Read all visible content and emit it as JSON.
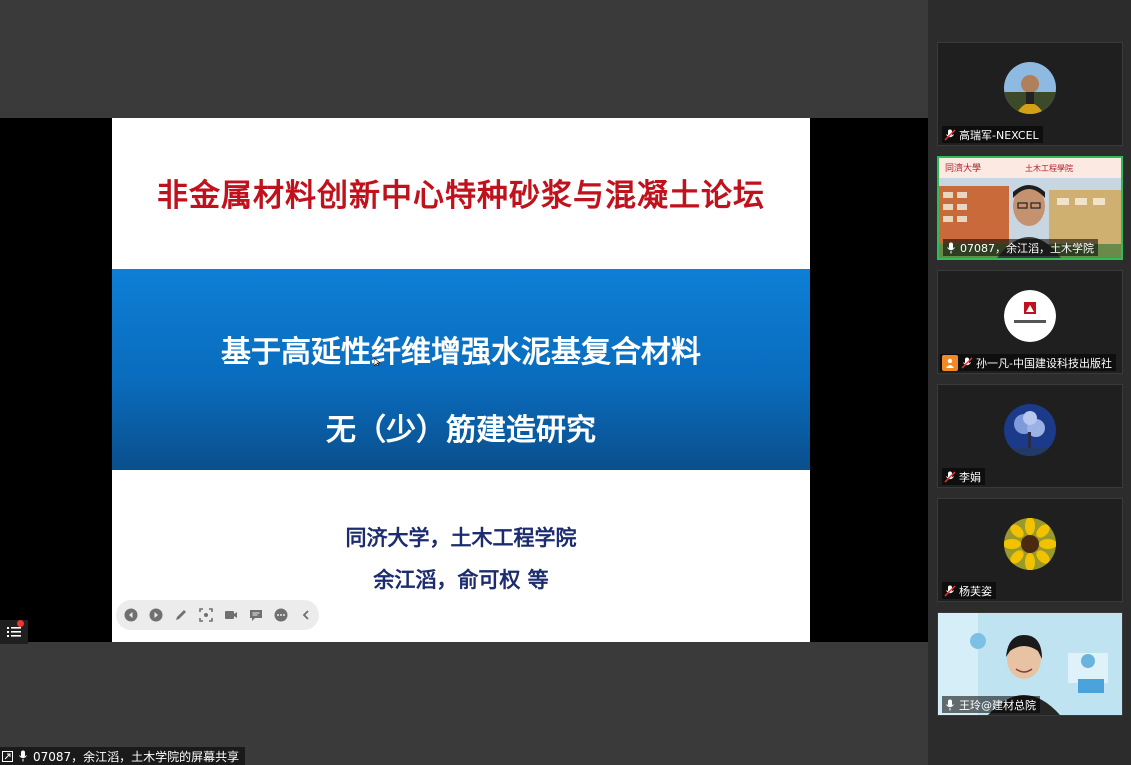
{
  "slide": {
    "title": "非金属材料创新中心特种砂浆与混凝土论坛",
    "subtitle_line1": "基于高延性纤维增强水泥基复合材料",
    "subtitle_line2": "无（少）筋建造研究",
    "affiliation": "同济大学，土木工程学院",
    "authors": "余江滔，俞可权 等"
  },
  "colors": {
    "title_red": "#c0121c",
    "band_blue": "#0a6cbd",
    "author_navy": "#1d2c6e",
    "active_speaker_border": "#2fbd5a"
  },
  "toolbar_icons": [
    "prev-icon",
    "next-icon",
    "pen-icon",
    "screenshot-icon",
    "camera-icon",
    "chat-icon",
    "more-icon",
    "collapse-icon"
  ],
  "status_bar": {
    "text": "07087，余江滔，土木学院的屏幕共享"
  },
  "participants": [
    {
      "name": "高瑞军-NEXCEL",
      "muted": true
    },
    {
      "name": "07087，余江滔，土木学院",
      "muted": false,
      "speaking": true
    },
    {
      "name": "孙一凡-中国建设科技出版社",
      "muted": true,
      "host": true
    },
    {
      "name": "李娟",
      "muted": true
    },
    {
      "name": "杨芙姿",
      "muted": true
    },
    {
      "name": "王玲@建材总院",
      "muted": false
    }
  ]
}
